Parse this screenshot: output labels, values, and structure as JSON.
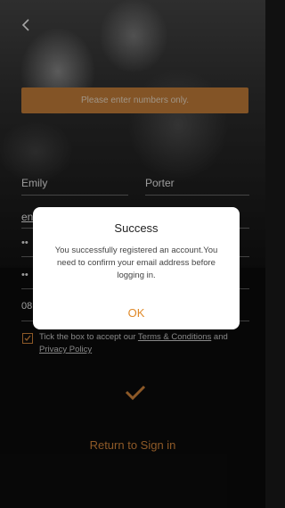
{
  "toast": {
    "message": "Please enter numbers only."
  },
  "form": {
    "first_name": "Emily",
    "last_name": "Porter",
    "email_partial": "en",
    "password_mask": "••",
    "confirm_mask": "••",
    "phone_partial": "08"
  },
  "terms": {
    "prefix": "Tick the box to accept our ",
    "terms_link": "Terms & Conditions",
    "middle": " and ",
    "privacy_link": "Privacy Policy"
  },
  "actions": {
    "return_label": "Return to Sign in"
  },
  "dialog": {
    "title": "Success",
    "message": "You successfully registered an account.You need to confirm your email address before logging in.",
    "ok_label": "OK"
  },
  "colors": {
    "accent": "#d9893d",
    "toast_bg": "#c9823b"
  }
}
